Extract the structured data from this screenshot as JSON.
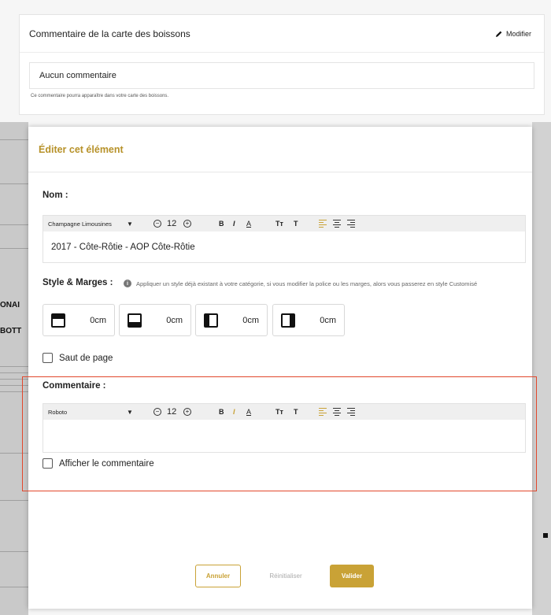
{
  "background": {
    "card_title": "Commentaire de la carte des boissons",
    "edit_label": "Modifier",
    "comment_value": "Aucun commentaire",
    "hint": "Ce commentaire pourra apparaître dans votre carte des boissons.",
    "left_fragments": [
      "ONAI",
      "BOTT"
    ]
  },
  "modal": {
    "title": "Éditer cet élément",
    "name_label": "Nom :",
    "name_editor": {
      "font": "Champagne Limousines",
      "size": "12",
      "value": "2017 - Côte-Rôtie - AOP Côte-Rôtie"
    },
    "style_label": "Style & Marges :",
    "style_hint": "Appliquer un style déjà existant à votre catégorie, si vous modifier la police ou les marges, alors vous passerez en style Customisé",
    "margins": [
      {
        "side": "top",
        "value": "0cm"
      },
      {
        "side": "bottom",
        "value": "0cm"
      },
      {
        "side": "left",
        "value": "0cm"
      },
      {
        "side": "right",
        "value": "0cm"
      }
    ],
    "page_break_label": "Saut de page",
    "comment_label": "Commentaire :",
    "comment_editor": {
      "font": "Roboto",
      "size": "12",
      "value": ""
    },
    "show_comment_label": "Afficher le commentaire",
    "buttons": {
      "cancel": "Annuler",
      "reset": "Réinitialiser",
      "validate": "Valider"
    },
    "toolbar_glyphs": {
      "bold": "B",
      "italic": "I",
      "underline": "A",
      "text_size": "Tт",
      "text": "T",
      "caret": "▼",
      "minus": "−",
      "plus": "+"
    }
  },
  "colors": {
    "accent": "#c9a236",
    "title_gold": "#b7922a",
    "highlight": "#e2472c"
  }
}
